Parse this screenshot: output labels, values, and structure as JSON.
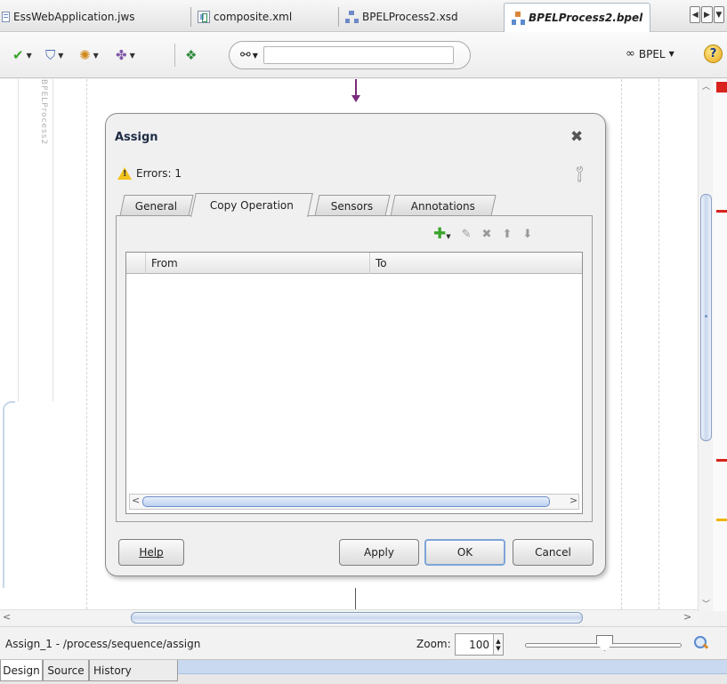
{
  "editor_tabs": [
    {
      "label": "EssWebApplication.jws",
      "icon": "workspace-icon"
    },
    {
      "label": "composite.xml",
      "icon": "composite-icon"
    },
    {
      "label": "BPELProcess2.xsd",
      "icon": "schema-icon"
    },
    {
      "label": "BPELProcess2.bpel",
      "icon": "bpel-icon",
      "active": true
    }
  ],
  "toolbar": {
    "bpel_menu_label": "BPEL",
    "search_value": ""
  },
  "canvas": {
    "lane_label": "BPELProcess2"
  },
  "dialog": {
    "title": "Assign",
    "errors_text": "Errors: 1",
    "tabs": [
      "General",
      "Copy Operation",
      "Sensors",
      "Annotations"
    ],
    "active_tab": "Copy Operation",
    "table": {
      "columns": [
        "",
        "From",
        "To"
      ],
      "rows": []
    },
    "buttons": {
      "help": "Help",
      "apply": "Apply",
      "ok": "OK",
      "cancel": "Cancel"
    }
  },
  "status": {
    "path": "Assign_1 - /process/sequence/assign",
    "zoom_label": "Zoom:",
    "zoom_value": "100"
  },
  "bottom_tabs": [
    "Design",
    "Source",
    "History"
  ],
  "colors": {
    "flow_arrow": "#7a2a7a",
    "error_marker": "#d9221c",
    "warning_marker": "#f0b400",
    "add_green": "#3aa52b"
  }
}
